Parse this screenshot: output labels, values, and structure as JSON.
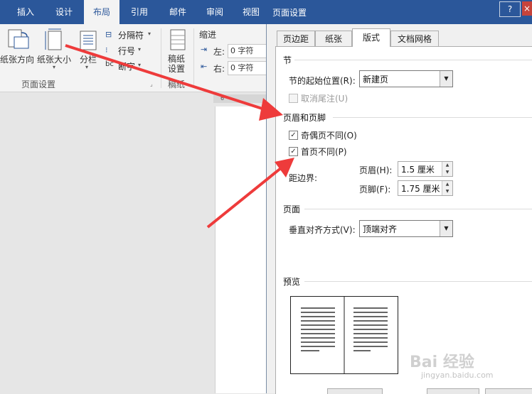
{
  "ribbon": {
    "tabs": [
      "插入",
      "设计",
      "布局",
      "引用",
      "邮件",
      "审阅",
      "视图"
    ],
    "active_tab": "布局",
    "buttons": {
      "orientation": "纸张方向",
      "size": "纸张大小",
      "columns": "分栏",
      "breaks": "分隔符",
      "line_numbers": "行号",
      "hyphenation": "断字",
      "draft_paper": "稿纸设置"
    },
    "group_page_setup": "页面设置",
    "group_draft": "稿纸",
    "indent": {
      "title": "缩进",
      "left_label": "左:",
      "left_value": "0 字符",
      "right_label": "右:",
      "right_value": "0 字符"
    },
    "ruler_mark": "6"
  },
  "dialog": {
    "title": "页面设置",
    "help_label": "?",
    "close_label": "×",
    "tabs": [
      "页边距",
      "纸张",
      "版式",
      "文档网格"
    ],
    "active_tab": "版式",
    "section": {
      "title": "节",
      "start_label": "节的起始位置(R):",
      "start_value": "新建页",
      "suppress_endnotes": "取消尾注(U)",
      "suppress_endnotes_checked": false
    },
    "header_footer": {
      "title": "页眉和页脚",
      "odd_even": "奇偶页不同(O)",
      "odd_even_checked": true,
      "first_page": "首页不同(P)",
      "first_page_checked": true,
      "from_edge_label": "距边界:",
      "header_label": "页眉(H):",
      "header_value": "1.5 厘米",
      "footer_label": "页脚(F):",
      "footer_value": "1.75 厘米"
    },
    "page": {
      "title": "页面",
      "valign_label": "垂直对齐方式(V):",
      "valign_value": "顶端对齐"
    },
    "preview": {
      "title": "预览"
    }
  },
  "watermark": {
    "text": "Bai 经验",
    "url": "jingyan.baidu.com"
  },
  "colors": {
    "ribbon_blue": "#2b579a",
    "arrow_red": "#ee3b3b",
    "dialog_bg": "#f0f0f0"
  }
}
